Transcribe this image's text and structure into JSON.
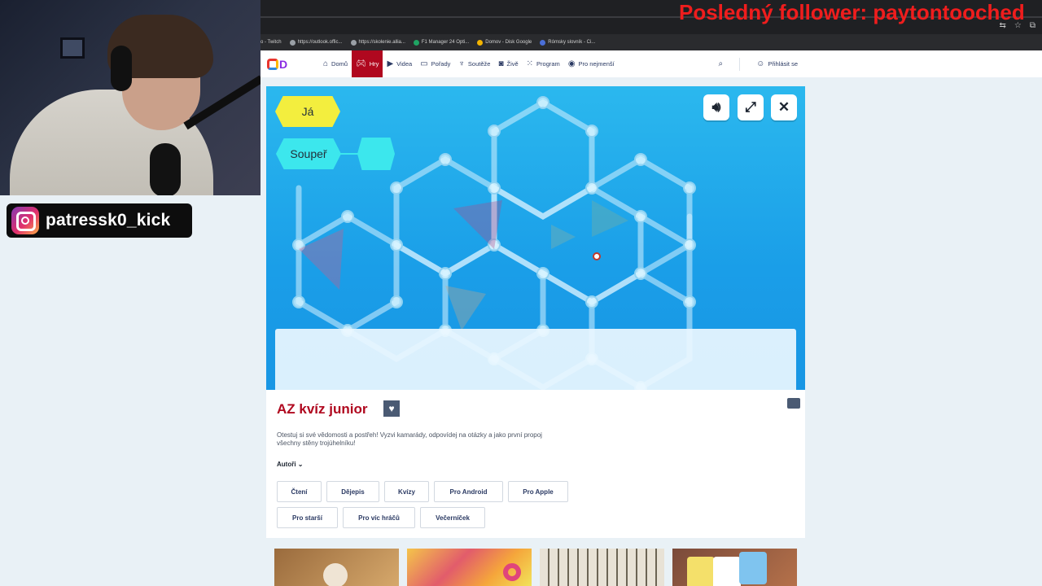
{
  "overlay": {
    "instagram_handle": "patressk0_kick",
    "follower_banner": "Posledný follower: paytontooched"
  },
  "bookmarks": [
    {
      "label": "o - Twitch"
    },
    {
      "label": "https://outlook.offic..."
    },
    {
      "label": "https://skolenie.allia..."
    },
    {
      "label": "F1 Manager 24 Opti..."
    },
    {
      "label": "Domov - Disk Google"
    },
    {
      "label": "Rómsky slovník - Ci..."
    }
  ],
  "site": {
    "logo_text": "D",
    "nav": [
      {
        "label": "Domů",
        "icon": "home-icon"
      },
      {
        "label": "Hry",
        "icon": "gamepad-icon",
        "active": true
      },
      {
        "label": "Videa",
        "icon": "play-icon"
      },
      {
        "label": "Pořady",
        "icon": "tv-icon"
      },
      {
        "label": "Soutěže",
        "icon": "trophy-icon"
      },
      {
        "label": "Živě",
        "icon": "camera-icon"
      },
      {
        "label": "Program",
        "icon": "grid-icon"
      },
      {
        "label": "Pro nejmenší",
        "icon": "globe-icon"
      }
    ],
    "login_label": "Přihlásit se"
  },
  "game": {
    "player_me": "Já",
    "player_opponent": "Soupeř"
  },
  "info": {
    "title": "AZ kvíz junior",
    "description": "Otestuj si své vědomosti a postřeh! Vyzvi kamarády, odpovídej na otázky a jako první propoj všechny stěny trojúhelníku!",
    "authors_label": "Autoři",
    "tags": [
      "Čtení",
      "Dějepis",
      "Kvízy",
      "Pro Android",
      "Pro Apple",
      "Pro starší",
      "Pro víc hráčů",
      "Večerníček"
    ]
  },
  "colors": {
    "brand_red": "#b0081f",
    "game_blue": "#1a9ee8",
    "hex_yellow": "#f3ee3e",
    "hex_cyan": "#3ce7ed",
    "follower_red": "#ef1d1d"
  }
}
